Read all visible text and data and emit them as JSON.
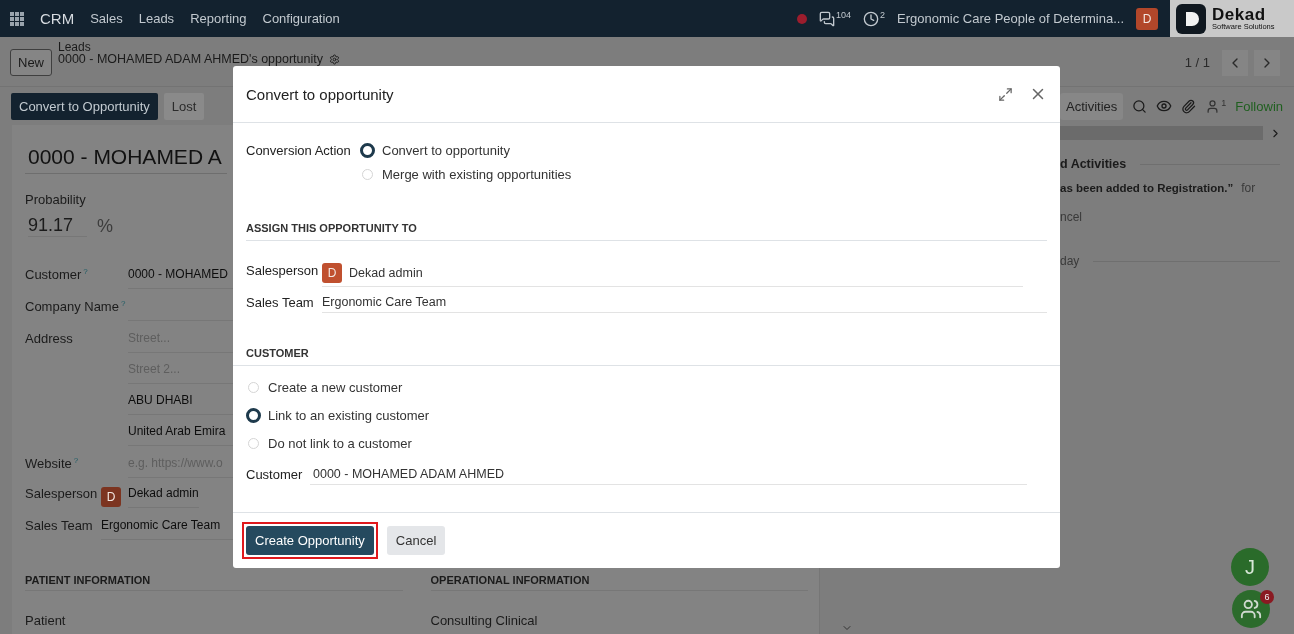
{
  "navbar": {
    "app": "CRM",
    "menus": [
      "Sales",
      "Leads",
      "Reporting",
      "Configuration"
    ],
    "messages_count": "104",
    "activities_count": "2",
    "company": "Ergonomic Care People of Determina...",
    "user_initial": "D",
    "logo": {
      "name": "Dekad",
      "tagline": "Software Solutions"
    }
  },
  "control_panel": {
    "new_button": "New",
    "breadcrumb": "Leads",
    "record": "0000 - MOHAMED ADAM AHMED's opportunity",
    "pager": "1 / 1"
  },
  "status_buttons": [
    {
      "label": "Convert to Opportunity",
      "kind": "primary"
    },
    {
      "label": "Lost",
      "kind": "secondary"
    }
  ],
  "form": {
    "title": "0000 - MOHAMED A",
    "probability_label": "Probability",
    "probability": "91.17",
    "percent": "%",
    "fields": [
      {
        "kind": "text",
        "label": "Customer",
        "help_mark": "?",
        "value": "0000 - MOHAMED"
      },
      {
        "kind": "text",
        "label": "Company Name",
        "help_mark": "?"
      },
      {
        "kind": "address",
        "label": "Address",
        "lines": [
          {
            "placeholder": "Street..."
          },
          {
            "placeholder": "Street 2..."
          },
          {
            "value": "ABU DHABI"
          },
          {
            "value": "United Arab Emira"
          }
        ]
      },
      {
        "kind": "text",
        "label": "Website",
        "help_mark": "?",
        "placeholder": "e.g. https://www.o"
      }
    ],
    "owner_fields": [
      {
        "kind": "user",
        "label": "Salesperson",
        "initial": "D",
        "value": "Dekad admin"
      },
      {
        "kind": "text",
        "label": "Sales Team",
        "value": "Ergonomic Care Team"
      }
    ],
    "sections": [
      {
        "title": "PATIENT INFORMATION",
        "labels": [
          "Patient"
        ]
      },
      {
        "title": "OPERATIONAL INFORMATION",
        "labels": [
          "Consulting Clinical"
        ]
      }
    ]
  },
  "chatter": {
    "activities_button": "Activities",
    "followers_count": "1",
    "follow_label": "Followin",
    "section_title": "d Activities",
    "activity_text": "as been added to Registration.”",
    "activity_suffix": "for",
    "action": "ncel",
    "date_separator": "day"
  },
  "dialog": {
    "title": "Convert to opportunity",
    "conversion": {
      "label": "Conversion Action",
      "options": [
        {
          "label": "Convert to opportunity",
          "selected": true
        },
        {
          "label": "Merge with existing opportunities",
          "selected": false
        }
      ]
    },
    "assign": {
      "title": "ASSIGN THIS OPPORTUNITY TO",
      "salesperson": {
        "label": "Salesperson",
        "initial": "D",
        "value": "Dekad admin"
      },
      "sales_team": {
        "label": "Sales Team",
        "value": "Ergonomic Care Team"
      }
    },
    "customer": {
      "title": "CUSTOMER",
      "options": [
        {
          "label": "Create a new customer",
          "selected": false
        },
        {
          "label": "Link to an existing customer",
          "selected": true
        },
        {
          "label": "Do not link to a customer",
          "selected": false
        }
      ],
      "field": {
        "label": "Customer",
        "value": "0000 - MOHAMED ADAM AHMED"
      }
    },
    "buttons": [
      {
        "label": "Create Opportunity",
        "kind": "primary",
        "highlighted": true
      },
      {
        "label": "Cancel",
        "kind": "secondary",
        "highlighted": false
      }
    ]
  },
  "assistant": {
    "user_initial": "J",
    "badge": "6"
  }
}
